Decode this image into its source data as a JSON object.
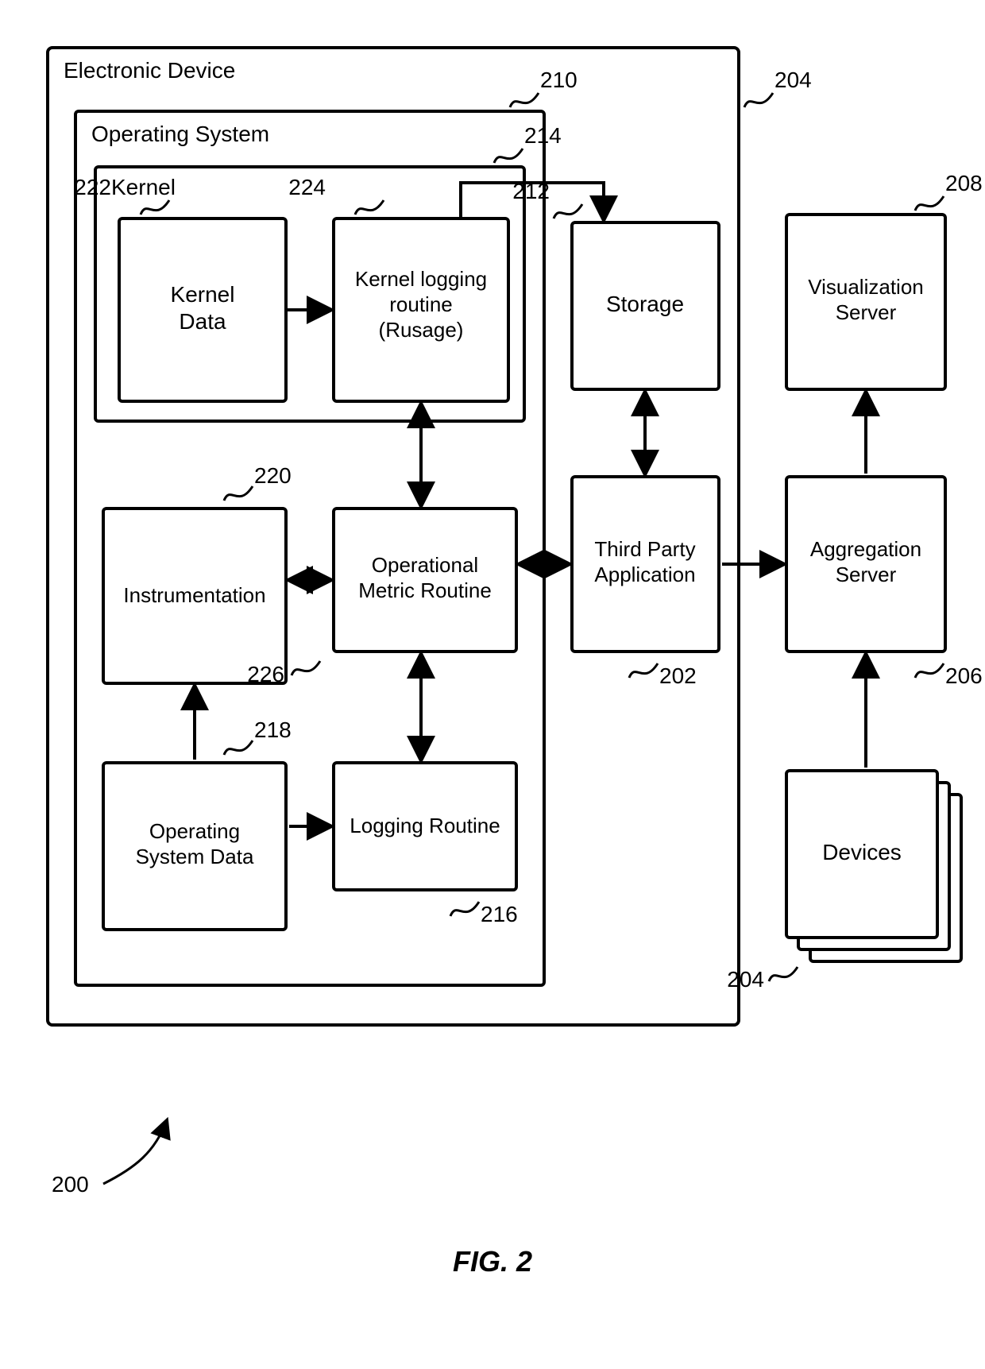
{
  "figure": "FIG. 2",
  "device": {
    "title": "Electronic Device",
    "ref": "204",
    "os": {
      "title": "Operating System",
      "ref": "210",
      "kernel": {
        "title": "Kernel",
        "ref": "214",
        "data": {
          "label": "Kernel\nData",
          "ref": "222"
        },
        "logger": {
          "label": "Kernel logging\nroutine\n(Rusage)",
          "ref": "224"
        }
      },
      "instrumentation": {
        "label": "Instrumentation",
        "ref": "220"
      },
      "opmetric": {
        "label": "Operational\nMetric Routine",
        "ref": "226"
      },
      "osdata": {
        "label": "Operating\nSystem Data",
        "ref": "218"
      },
      "logging": {
        "label": "Logging Routine",
        "ref": "216"
      }
    },
    "storage": {
      "label": "Storage",
      "ref": "212"
    },
    "tpa": {
      "label": "Third Party\nApplication",
      "ref": "202"
    }
  },
  "agg": {
    "label": "Aggregation\nServer",
    "ref": "206"
  },
  "viz": {
    "label": "Visualization\nServer",
    "ref": "208"
  },
  "devices": {
    "label": "Devices",
    "ref": "204"
  },
  "page_ref": "200"
}
